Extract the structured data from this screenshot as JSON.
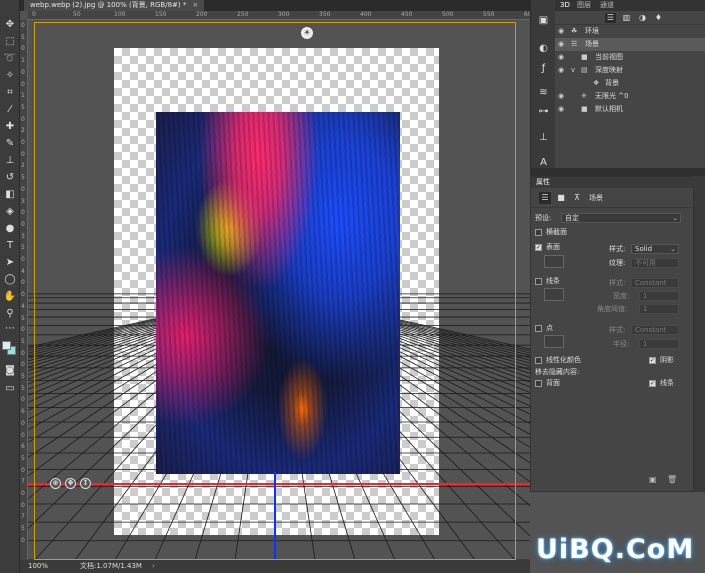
{
  "document_tab": {
    "title": "webp.webp (2).jpg @ 100% (背景, RGB/8#) *",
    "close": "×"
  },
  "ruler": {
    "h_ticks": [
      "0",
      "50",
      "100",
      "150",
      "200",
      "250",
      "300",
      "350",
      "400",
      "450",
      "500",
      "550",
      "600"
    ],
    "v_ticks": [
      "0",
      "5",
      "0",
      "1",
      "0",
      "0",
      "1",
      "5",
      "0",
      "2",
      "0",
      "0",
      "2",
      "5",
      "0",
      "3",
      "0",
      "0",
      "3",
      "5",
      "0",
      "4",
      "0",
      "0",
      "4",
      "5",
      "0",
      "5",
      "0",
      "0",
      "5",
      "5",
      "0",
      "6",
      "0",
      "0",
      "6",
      "5",
      "0",
      "7",
      "0",
      "0",
      "7",
      "5",
      "0"
    ]
  },
  "status": {
    "zoom": "100%",
    "doc_info": "文档:1.07M/1.43M",
    "arrow": "›"
  },
  "panel_3d": {
    "tabs": [
      "3D",
      "图层",
      "通道"
    ],
    "active_tab": "3D",
    "items": [
      {
        "label": "环境",
        "icon": "tree-icon"
      },
      {
        "label": "场景",
        "icon": "scene-icon",
        "selected": true
      },
      {
        "label": "当前视图",
        "icon": "camera-icon"
      },
      {
        "label": "深度映射",
        "icon": "mesh-icon",
        "expander": "v"
      },
      {
        "label": "背景",
        "icon": "material-icon"
      },
      {
        "label": "无限光 ^0",
        "icon": "light-icon"
      },
      {
        "label": "默认相机",
        "icon": "camera-icon"
      }
    ]
  },
  "properties": {
    "title": "属性",
    "scene_name": "场景",
    "preset_label": "预设:",
    "preset_value": "自定",
    "cross_section": "横截面",
    "surface": {
      "label": "表面",
      "style_label": "样式:",
      "style_value": "Solid",
      "texture_label": "纹理:",
      "texture_value": "不可用"
    },
    "lines": {
      "label": "线条",
      "style_label": "样式:",
      "style_value": "Constant",
      "width_label": "宽度:",
      "width_value": "1",
      "angle_label": "角度阈值:",
      "angle_value": "1"
    },
    "points": {
      "label": "点",
      "style_label": "样式:",
      "style_value": "Constant",
      "radius_label": "半径:",
      "radius_value": "1"
    },
    "linearize_colors": "线性化颜色",
    "shadow": "阴影",
    "remove_hidden": "移去隐藏内容:",
    "backface": "背面",
    "lines_cb": "线条"
  },
  "watermark": "UiBQ.CoM",
  "colors": {
    "accent_frame": "#c9a100",
    "x_axis": "#ff2020",
    "z_axis": "#1030ff",
    "bg_swatch": "#8ee2e2"
  }
}
